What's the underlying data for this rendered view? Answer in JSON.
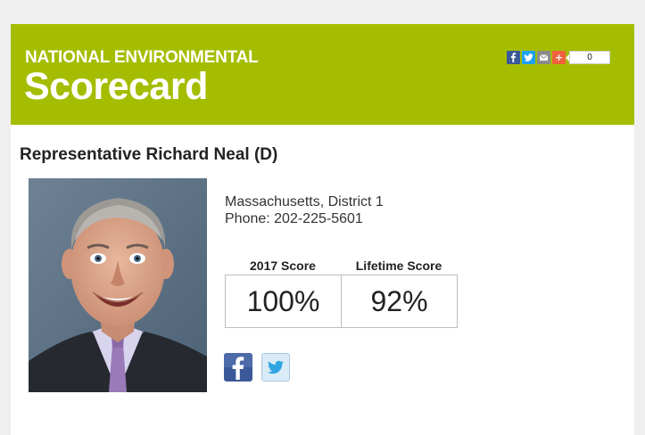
{
  "banner": {
    "kicker": "NATIONAL ENVIRONMENTAL",
    "title": "Scorecard",
    "color": "#a5bd00"
  },
  "share": {
    "icons": [
      "facebook-icon",
      "twitter-icon",
      "email-icon",
      "plus-icon"
    ],
    "plus_glyph": "+",
    "count": "0"
  },
  "representative": {
    "name": "Representative Richard Neal (D)",
    "district": "Massachusetts, District 1",
    "phone": "Phone: 202-225-5601"
  },
  "scores": {
    "year_label": "2017 Score",
    "year_value": "100%",
    "lifetime_label": "Lifetime Score",
    "lifetime_value": "92%"
  },
  "social": {
    "icons": [
      "facebook-icon",
      "twitter-icon"
    ]
  }
}
